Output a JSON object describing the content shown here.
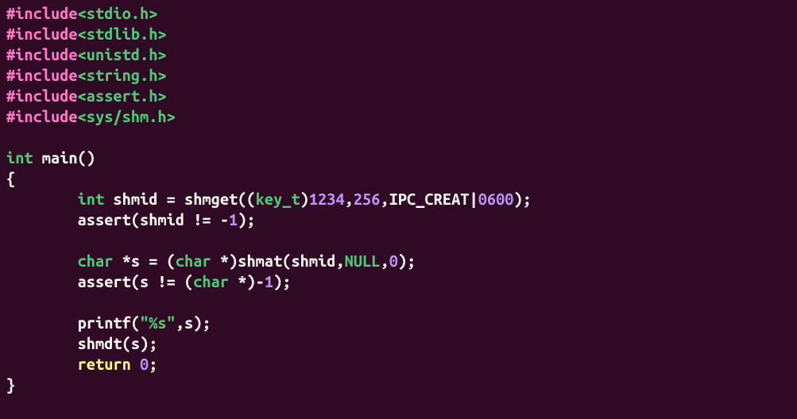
{
  "lines": {
    "l1": {
      "include": "#include",
      "path": "<stdio.h>"
    },
    "l2": {
      "include": "#include",
      "path": "<stdlib.h>"
    },
    "l3": {
      "include": "#include",
      "path": "<unistd.h>"
    },
    "l4": {
      "include": "#include",
      "path": "<string.h>"
    },
    "l5": {
      "include": "#include",
      "path": "<assert.h>"
    },
    "l6": {
      "include": "#include",
      "path": "<sys/shm.h>"
    },
    "l8": {
      "type": "int",
      "func": " main",
      "parens": "()"
    },
    "l9": {
      "brace": "{"
    },
    "l10": {
      "indent": "        ",
      "type": "int",
      "var": " shmid ",
      "eq": "= ",
      "func": "shmget",
      "paren_open": "((",
      "cast_type": "key_t",
      "paren_close1": ")",
      "num1": "1234",
      "comma1": ",",
      "num2": "256",
      "comma2": ",",
      "const1": "IPC_CREAT",
      "pipe": "|",
      "num3": "0600",
      "paren_end": ");"
    },
    "l11": {
      "indent": "        ",
      "func": "assert",
      "paren_open": "(",
      "var": "shmid ",
      "op": "!= ",
      "neg": "-",
      "num": "1",
      "paren_end": ");"
    },
    "l13": {
      "indent": "        ",
      "type1": "char",
      "star_var": " *s ",
      "eq": "= ",
      "paren_open": "(",
      "type2": "char",
      "star_close": " *)",
      "func": "shmat",
      "paren_open2": "(",
      "var": "shmid",
      "comma1": ",",
      "null": "NULL",
      "comma2": ",",
      "num": "0",
      "paren_end": ");"
    },
    "l14": {
      "indent": "        ",
      "func": "assert",
      "paren_open": "(",
      "var": "s ",
      "op": "!= ",
      "paren_cast_open": "(",
      "type": "char",
      "star_close": " *)",
      "neg": "-",
      "num": "1",
      "paren_end": ");"
    },
    "l16": {
      "indent": "        ",
      "func": "printf",
      "paren_open": "(",
      "str": "\"%s\"",
      "comma": ",",
      "var": "s",
      "paren_end": ");"
    },
    "l17": {
      "indent": "        ",
      "func": "shmdt",
      "paren_open": "(",
      "var": "s",
      "paren_end": ");"
    },
    "l18": {
      "indent": "        ",
      "ret": "return",
      "space": " ",
      "num": "0",
      "semi": ";"
    },
    "l19": {
      "brace": "}"
    }
  }
}
